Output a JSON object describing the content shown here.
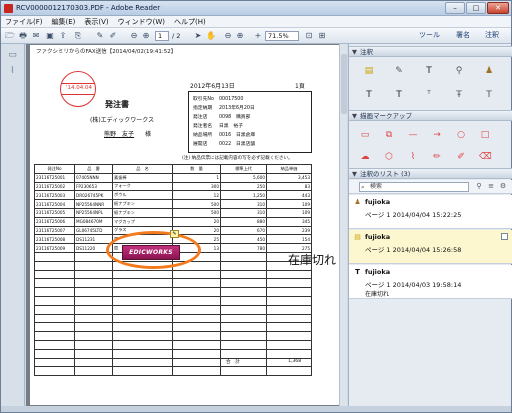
{
  "window": {
    "title": "RCV0000012170303.PDF - Adobe Reader",
    "min": "–",
    "max": "□",
    "close": "✕"
  },
  "menu": [
    "ファイル(F)",
    "編集(E)",
    "表示(V)",
    "ウィンドウ(W)",
    "ヘルプ(H)"
  ],
  "toolbar": {
    "page_current": "1",
    "page_total": "/ 2",
    "zoom": "71.5%",
    "links": {
      "tools": "ツール",
      "sign": "署名",
      "comment": "注釈"
    }
  },
  "document": {
    "header_line": "ファクシミリからのFAX送信【2014/04/02(19:41:52】",
    "stamp_date": "'14.04.04",
    "title": "発注書",
    "company": "(株)エディックワークス",
    "contact_name": "熊野　友子",
    "honorific": "様",
    "date": "2012年6月13日",
    "page_label": "1頁",
    "info": [
      {
        "k": "取引先No",
        "v": "00017500"
      },
      {
        "k": "指定納期",
        "v": "2013年6月20日"
      },
      {
        "k": "発注店",
        "v": "0098　購買部"
      },
      {
        "k": "発注者名",
        "v": "日黒　裕子"
      },
      {
        "k": "納品場所",
        "v": "0016　日黒倉庫"
      },
      {
        "k": "展開店",
        "v": "0022　日黒店舗"
      }
    ],
    "note": "(注) 納品伝票には記載内容の写を必ず記載ください。",
    "table_headers": [
      "発注No",
      "品　番",
      "品　名",
      "数　量",
      "標準上代",
      "納品単価"
    ],
    "rows": [
      [
        "23116T25001",
        "07405NNN",
        "素振棒",
        "1",
        "5,600",
        "3,453"
      ],
      [
        "23116T25002",
        "FP230653",
        "フォーク",
        "300",
        "250",
        "83"
      ],
      [
        "23116T25003",
        "DR026745PK",
        "ボウル",
        "12",
        "1,250",
        "443"
      ],
      [
        "23116T25004",
        "NP25564NNR",
        "紙ナプキン",
        "500",
        "310",
        "109"
      ],
      [
        "23116T25005",
        "NP25564NPL",
        "紙ナプキン",
        "500",
        "310",
        "109"
      ],
      [
        "23116T25006",
        "MG084670M",
        "マグカップ",
        "20",
        "880",
        "345"
      ],
      [
        "23116T25007",
        "GL06745LTD",
        "グラス",
        "20",
        "670",
        "239"
      ],
      [
        "23116T25008",
        "DS11231",
        "皿",
        "25",
        "450",
        "154"
      ],
      [
        "23116T25009",
        "DS11220",
        "皿",
        "13",
        "780",
        "275"
      ]
    ],
    "sticker_text": "EDICWORKS",
    "overlay_note": "在庫切れ",
    "total_label": "合　計",
    "total_value": "1,368"
  },
  "right_panel": {
    "annotations_header": "注釈",
    "drawing_header": "描画マークアップ",
    "list_header": "注釈のリスト (3)",
    "search_placeholder": "検索",
    "items": [
      {
        "author": "fujioka",
        "meta": "ページ 1  2014/04/04 15:22:25",
        "body": ""
      },
      {
        "author": "fujioka",
        "meta": "ページ 1  2014/04/04 15:26:58",
        "body": ""
      },
      {
        "author": "fujioka",
        "meta": "ページ 1  2014/04/03 19:58:14",
        "body": "在庫切れ"
      }
    ]
  },
  "colors": {
    "accent": "#f47b1d",
    "stamp": "#dd3333",
    "sticker": "#a01e64"
  }
}
